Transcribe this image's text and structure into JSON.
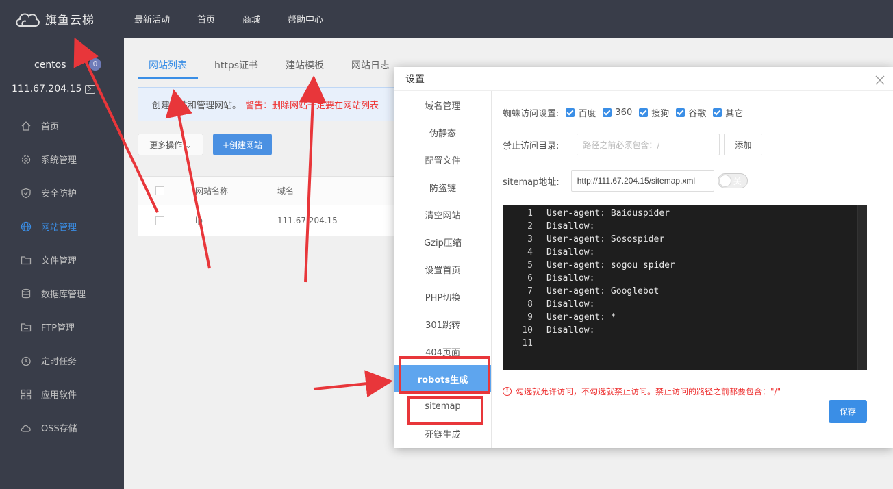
{
  "app": {
    "logo_text": "旗鱼云梯",
    "top_nav": [
      "最新活动",
      "首页",
      "商城",
      "帮助中心"
    ]
  },
  "sidebar": {
    "user": "centos",
    "badge": "0",
    "ip": "111.67.204.15",
    "items": [
      {
        "label": "首页",
        "icon": "home-icon"
      },
      {
        "label": "系统管理",
        "icon": "gear-icon"
      },
      {
        "label": "安全防护",
        "icon": "shield-icon"
      },
      {
        "label": "网站管理",
        "icon": "globe-icon",
        "active": true
      },
      {
        "label": "文件管理",
        "icon": "folder-icon"
      },
      {
        "label": "数据库管理",
        "icon": "database-icon"
      },
      {
        "label": "FTP管理",
        "icon": "ftp-icon"
      },
      {
        "label": "定时任务",
        "icon": "clock-icon"
      },
      {
        "label": "应用软件",
        "icon": "apps-icon"
      },
      {
        "label": "OSS存储",
        "icon": "cloud-storage-icon"
      }
    ]
  },
  "main": {
    "tabs": [
      "网站列表",
      "https证书",
      "建站模板",
      "网站日志"
    ],
    "notice": "创建网站和管理网站。",
    "notice_warn": "警告：删除网站一定要在网站列表",
    "more_btn": "更多操作 ⌄",
    "create_btn": "+创建网站",
    "table": {
      "headers": [
        "网站名称",
        "域名"
      ],
      "rows": [
        [
          "ip",
          "111.67.204.15"
        ]
      ]
    }
  },
  "modal": {
    "title": "设置",
    "nav": [
      "域名管理",
      "伪静态",
      "配置文件",
      "防盗链",
      "清空网站",
      "Gzip压缩",
      "设置首页",
      "PHP切换",
      "301跳转",
      "404页面",
      "robots生成",
      "sitemap",
      "死链生成"
    ],
    "active_nav": "robots生成",
    "spider_label": "蜘蛛访问设置:",
    "spiders": [
      "百度",
      "360",
      "搜狗",
      "谷歌",
      "其它"
    ],
    "dir_label": "禁止访问目录:",
    "dir_placeholder": "路径之前必须包含：/",
    "add_btn": "添加",
    "sitemap_label": "sitemap地址:",
    "sitemap_value": "http://111.67.204.15/sitemap.xml",
    "toggle_text": "关",
    "line_numbers": [
      "1",
      "2",
      "3",
      "4",
      "5",
      "6",
      "7",
      "8",
      "9",
      "10",
      "11"
    ],
    "code_lines": [
      "User-agent: Baiduspider",
      "Disallow:",
      "User-agent: Sosospider",
      "Disallow:",
      "User-agent: sogou spider",
      "Disallow:",
      "User-agent: Googlebot",
      "Disallow:",
      "User-agent: *",
      "Disallow:",
      ""
    ],
    "tip_text": "勾选就允许访问，不勾选就禁止访问。禁止访问的路径之前都要包含：\"/\"",
    "save_btn": "保存"
  },
  "colors": {
    "accent": "#3a8ee6",
    "sidebar_bg": "#393d49",
    "annotation_red": "#e8363a"
  }
}
